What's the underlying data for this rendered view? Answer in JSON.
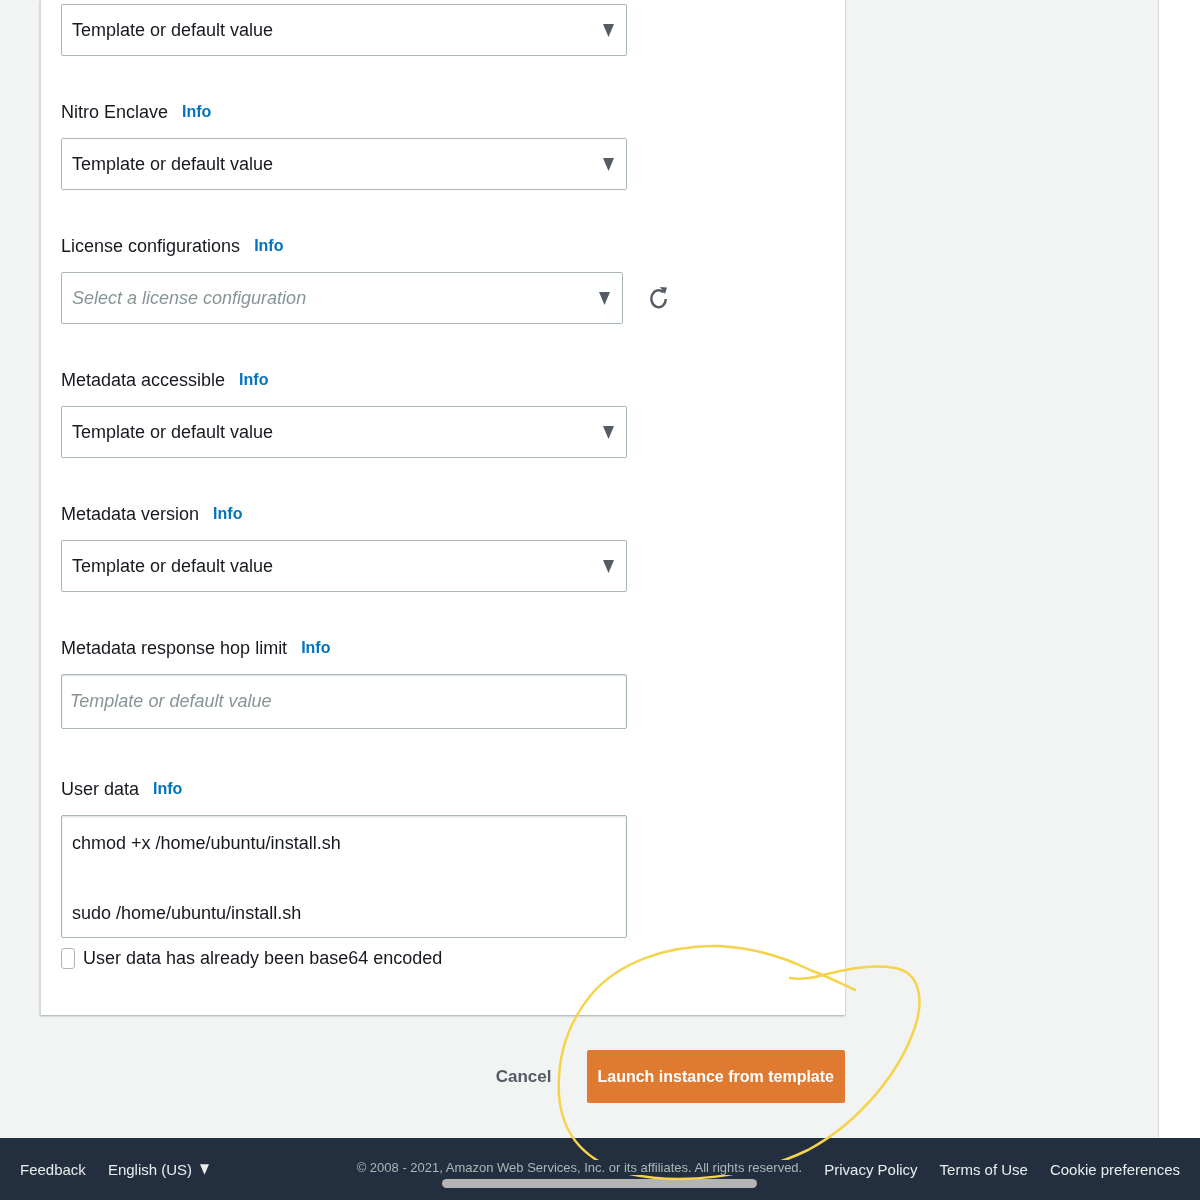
{
  "form": {
    "fields": [
      {
        "kind": "select",
        "value": "Template or default value"
      },
      {
        "kind": "select",
        "label": "Nitro Enclave",
        "info": "Info",
        "value": "Template or default value"
      },
      {
        "kind": "select",
        "label": "License configurations",
        "info": "Info",
        "placeholder": "Select a license configuration",
        "refresh": true
      },
      {
        "kind": "select",
        "label": "Metadata accessible",
        "info": "Info",
        "value": "Template or default value"
      },
      {
        "kind": "select",
        "label": "Metadata version",
        "info": "Info",
        "value": "Template or default value"
      },
      {
        "kind": "input",
        "label": "Metadata response hop limit",
        "info": "Info",
        "placeholder": "Template or default value"
      },
      {
        "kind": "textarea",
        "label": "User data",
        "info": "Info",
        "value": "chmod +x /home/ubuntu/install.sh\n\nsudo /home/ubuntu/install.sh"
      }
    ],
    "checkbox": {
      "label": "User data has already been base64 encoded",
      "checked": false
    }
  },
  "actions": {
    "cancel": "Cancel",
    "primary": "Launch instance from template"
  },
  "footer": {
    "feedback": "Feedback",
    "language": "English (US)",
    "copyright": "© 2008 - 2021, Amazon Web Services, Inc. or its affiliates. All rights reserved.",
    "links": [
      "Privacy Policy",
      "Terms of Use",
      "Cookie preferences"
    ]
  }
}
